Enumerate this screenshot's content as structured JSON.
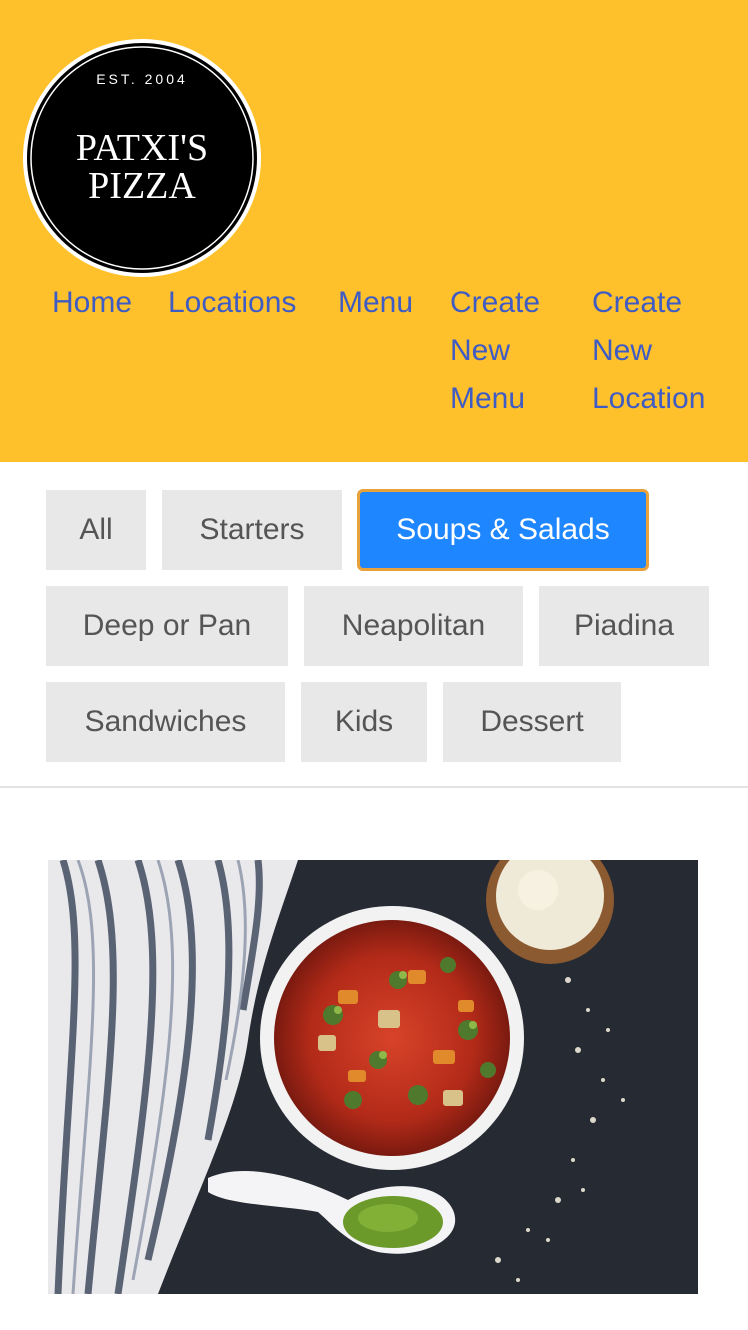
{
  "brand": {
    "logo_top": "EST. 2004",
    "logo_line1": "PATXI'S",
    "logo_line2": "PIZZA"
  },
  "nav": {
    "home": "Home",
    "locations": "Locations",
    "menu": "Menu",
    "create_menu": "Create New Menu",
    "create_location": "Create New Location"
  },
  "filters": {
    "all": "All",
    "starters": "Starters",
    "soups_salads": "Soups & Salads",
    "deep_pan": "Deep or Pan",
    "neapolitan": "Neapolitan",
    "piadina": "Piadina",
    "sandwiches": "Sandwiches",
    "kids": "Kids",
    "dessert": "Dessert",
    "active": "Soups & Salads"
  },
  "colors": {
    "header_bg": "#FFC12B",
    "nav_link": "#3F5BC4",
    "filter_bg": "#E8E8E8",
    "filter_active_bg": "#1E86FF",
    "filter_active_border": "#E8A23C"
  }
}
